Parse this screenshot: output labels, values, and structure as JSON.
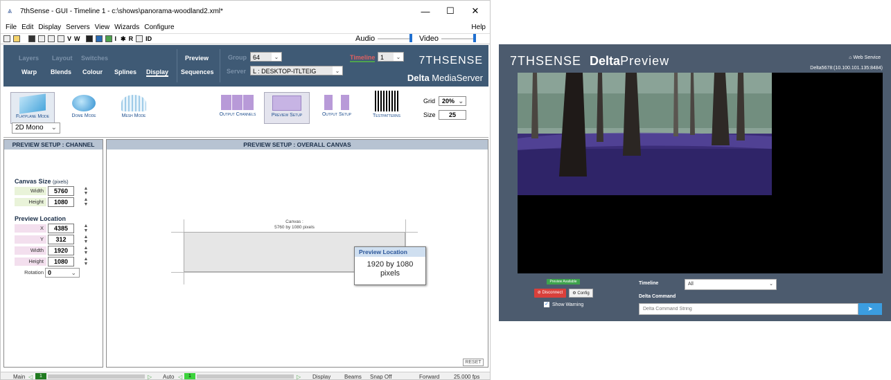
{
  "app_window": {
    "title": "7thSense -  GUI  - Timeline 1 - c:\\shows\\panorama-woodland2.xml*",
    "window_controls": {
      "minimize": "—",
      "maximize": "☐",
      "close": "✕"
    },
    "menu": [
      "File",
      "Edit",
      "Display",
      "Servers",
      "View",
      "Wizards",
      "Configure"
    ],
    "help": "Help",
    "toolbar": {
      "audio_label": "Audio",
      "video_label": "Video",
      "icons_text": [
        "V",
        "W",
        "I",
        "R",
        "ID"
      ]
    },
    "ribbon": {
      "row1": [
        "Layers",
        "Layout",
        "Switches"
      ],
      "row2": [
        "Warp",
        "Blends",
        "Colour",
        "Splines",
        "Display"
      ],
      "preview": "Preview",
      "sequences": "Sequences",
      "group_label": "Group",
      "group_value": "64",
      "server_label": "Server",
      "server_value": "L : DESKTOP-ITLTEIG",
      "timeline_label": "Timeline",
      "timeline_value": "1",
      "brand": "7THSENSE",
      "product_bold": "Delta",
      "product_rest": " MediaServer"
    },
    "modes": [
      "Flatplane Mode",
      "Dome Mode",
      "Mesh Mode"
    ],
    "mode_select": "2D Mono",
    "tools": [
      "Output Channels",
      "Preview Setup",
      "Output Setup",
      "Testpatterns"
    ],
    "grid_label": "Grid",
    "grid_value": "20%",
    "size_label": "Size",
    "size_value": "25",
    "left_panel": {
      "header": "PREVIEW SETUP : CHANNEL",
      "canvas_size": "Canvas Size",
      "canvas_units": "(pixels)",
      "width_label": "Width",
      "width_value": "5760",
      "height_label": "Height",
      "height_value": "1080",
      "preview_location": "Preview Location",
      "x_label": "X",
      "x_value": "4385",
      "y_label": "Y",
      "y_value": "312",
      "pw_label": "Width",
      "pw_value": "1920",
      "ph_label": "Height",
      "ph_value": "1080",
      "rotation_label": "Rotation",
      "rotation_value": "0"
    },
    "right_panel": {
      "header": "PREVIEW SETUP : OVERALL CANVAS",
      "canvas_title": "Canvas :",
      "canvas_desc": "5760 by 1080 pixels",
      "tooltip_title": "Preview Location",
      "tooltip_line1": "1920 by 1080",
      "tooltip_line2": "pixels",
      "reset": "RESET"
    },
    "status": {
      "main": "Main",
      "auto": "Auto",
      "display": "Display",
      "beams": "Beams",
      "snap": "Snap Off",
      "direction": "Forward",
      "fps": "25.000 fps",
      "main_digit": "1",
      "auto_digit": "1"
    }
  },
  "delta_preview": {
    "brand": "7THSENSE",
    "title_bold": "Delta",
    "title_rest": "Preview",
    "web_service": "Web Service",
    "address": "Delta5678:(10.100.101.135:8484)",
    "preview_available": "Preview Available",
    "disconnect": "Disconnect",
    "config": "Config",
    "show_warning": "Show Warning",
    "timeline_label": "Timeline",
    "timeline_value": "All",
    "delta_command_label": "Delta Command",
    "delta_command_placeholder": "Delta Command String"
  }
}
